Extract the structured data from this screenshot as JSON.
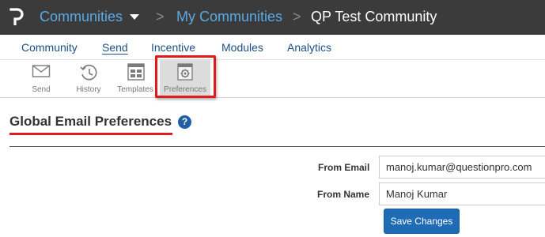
{
  "breadcrumb": {
    "root": "Communities",
    "level2": "My Communities",
    "current": "QP Test Community",
    "separator": ">"
  },
  "tabs": [
    {
      "label": "Community",
      "active": false
    },
    {
      "label": "Send",
      "active": true
    },
    {
      "label": "Incentive",
      "active": false
    },
    {
      "label": "Modules",
      "active": false
    },
    {
      "label": "Analytics",
      "active": false
    }
  ],
  "toolbar": [
    {
      "label": "Send",
      "icon": "envelope-icon"
    },
    {
      "label": "History",
      "icon": "history-icon"
    },
    {
      "label": "Templates",
      "icon": "templates-icon"
    },
    {
      "label": "Preferences",
      "icon": "preferences-icon",
      "active": true
    }
  ],
  "page": {
    "title": "Global Email Preferences",
    "help_glyph": "?"
  },
  "form": {
    "from_email_label": "From Email",
    "from_email_value": "manoj.kumar@questionpro.com",
    "from_name_label": "From Name",
    "from_name_value": "Manoj Kumar",
    "save_label": "Save Changes"
  },
  "colors": {
    "topbar": "#3b3b3b",
    "link": "#5aaae6",
    "tab": "#1d4f86",
    "highlight": "#e01b1b",
    "button": "#1e6cb5"
  }
}
